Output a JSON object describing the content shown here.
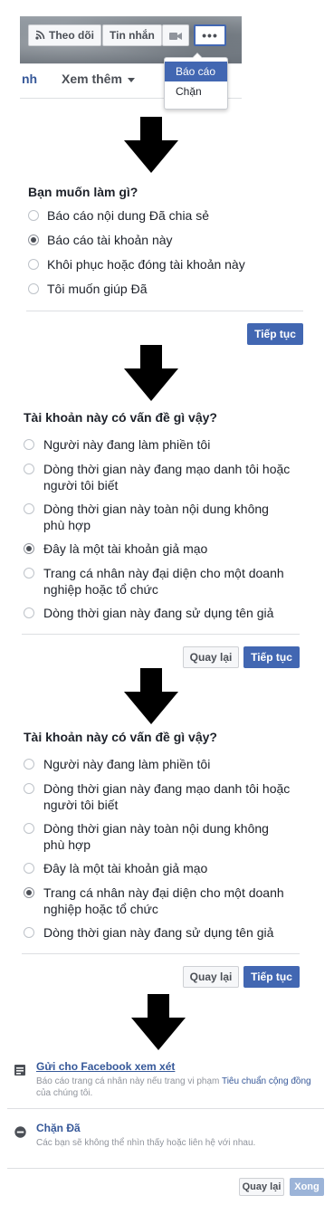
{
  "header": {
    "follow_label": "Theo dõi",
    "message_label": "Tin nhắn",
    "more_dots": "•••",
    "tab_fragment": "nh",
    "see_more_label": "Xem thêm",
    "menu": {
      "report": "Báo cáo",
      "block": "Chặn"
    }
  },
  "step1": {
    "title": "Bạn muốn làm gì?",
    "options": [
      "Báo cáo nội dung Đã chia sẻ",
      "Báo cáo tài khoản này",
      "Khôi phục hoặc đóng tài khoản này",
      "Tôi muốn giúp Đã"
    ],
    "selected_index": 1,
    "continue_label": "Tiếp tục"
  },
  "step2": {
    "title": "Tài khoản này có vấn đề gì vậy?",
    "options": [
      "Người này đang làm phiền tôi",
      [
        "Dòng thời gian này đang mạo danh tôi hoặc",
        "người tôi biết"
      ],
      [
        "Dòng thời gian này toàn nội dung không",
        "phù hợp"
      ],
      "Đây là một tài khoản giả mạo",
      [
        "Trang cá nhân này đại diện cho một doanh",
        "nghiệp hoặc tổ chức"
      ],
      "Dòng thời gian này đang sử dụng tên giả"
    ],
    "selected_index": 3,
    "back_label": "Quay lại",
    "continue_label": "Tiếp tục"
  },
  "step3": {
    "title": "Tài khoản này có vấn đề gì vậy?",
    "options": [
      "Người này đang làm phiền tôi",
      [
        "Dòng thời gian này đang mạo danh tôi hoặc",
        "người tôi biết"
      ],
      [
        "Dòng thời gian này toàn nội dung không",
        "phù hợp"
      ],
      "Đây là một tài khoản giả mạo",
      [
        "Trang cá nhân này đại diện cho một doanh",
        "nghiệp hoặc tổ chức"
      ],
      "Dòng thời gian này đang sử dụng tên giả"
    ],
    "selected_index": 4,
    "back_label": "Quay lại",
    "continue_label": "Tiếp tục"
  },
  "step4": {
    "send_title": "Gửi cho Facebook xem xét",
    "send_desc_1": "Báo cáo trang cá nhân này nếu trang vi phạm ",
    "send_desc_link": "Tiêu chuẩn cộng đồng",
    "send_desc_2": "của chúng tôi.",
    "block_title": "Chặn Đã",
    "block_desc": "Các bạn sẽ không thể nhìn thấy hoặc liên hệ với nhau.",
    "back_label": "Quay lại",
    "done_label": "Xong"
  },
  "colors": {
    "primary": "#4267b2",
    "link": "#365899",
    "disabled": "#9cb4d8",
    "text": "#1d2129",
    "muted": "#90949c"
  }
}
